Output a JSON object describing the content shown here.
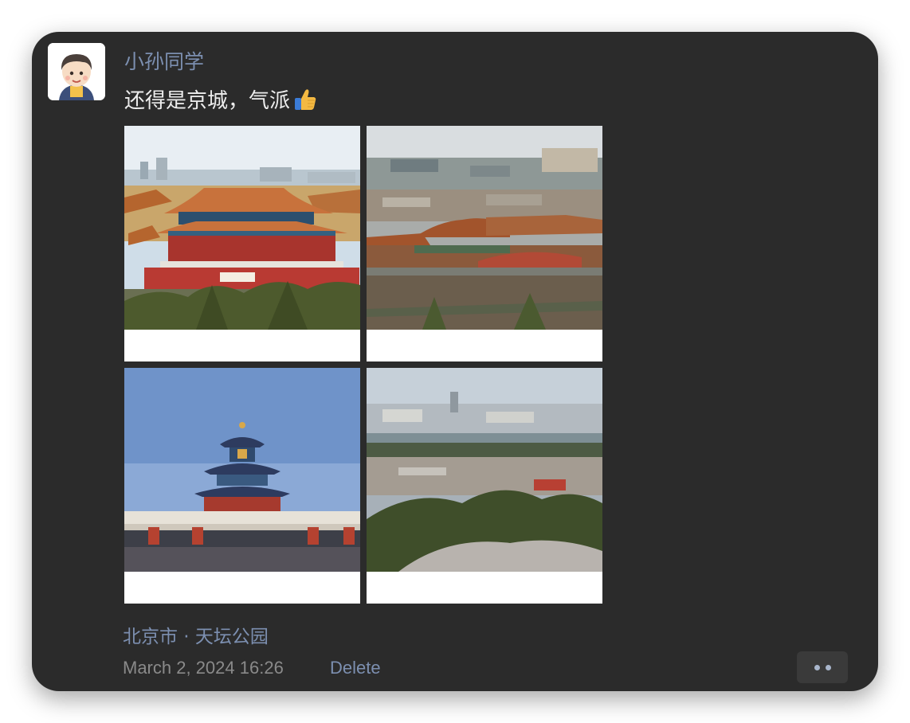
{
  "post": {
    "username": "小孙同学",
    "text": "还得是京城，气派",
    "location": "北京市 · 天坛公园",
    "timestamp": "March 2, 2024 16:26",
    "delete_label": "Delete",
    "photos": [
      {
        "subject": "forbidden-city-hall"
      },
      {
        "subject": "forbidden-city-rooftops"
      },
      {
        "subject": "temple-of-heaven"
      },
      {
        "subject": "jingshan-view"
      }
    ]
  },
  "icons": {
    "avatar": "cartoon-boy-avatar",
    "emoji": "thumbs-up-emoji",
    "more": "more-dots-icon"
  },
  "colors": {
    "card_background": "#2b2b2b",
    "username": "#7c8fb0",
    "text": "#ededed",
    "link": "#7c8fb0",
    "timestamp": "#8a8a8a"
  }
}
